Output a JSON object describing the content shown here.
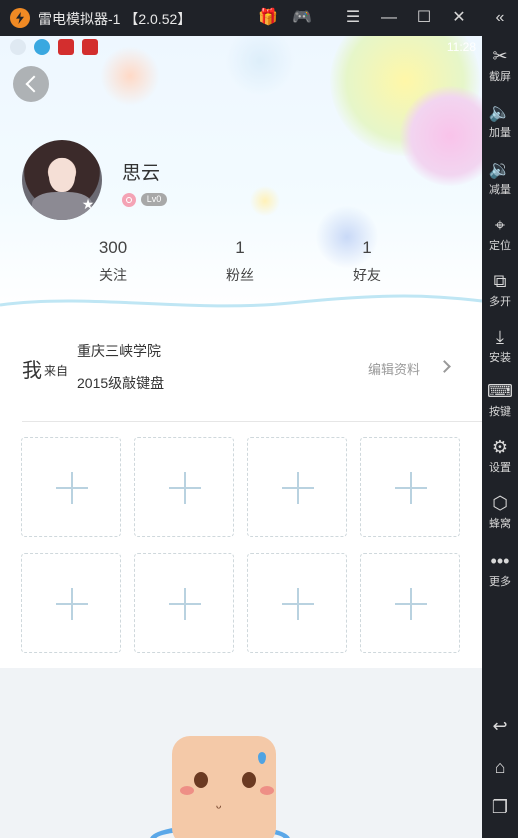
{
  "window": {
    "title": "雷电模拟器-1 【2.0.52】",
    "icons": [
      "gift-icon",
      "gamepad-icon",
      "menu-icon",
      "minimize-icon",
      "maximize-icon",
      "close-icon",
      "collapse-sidebar-icon"
    ]
  },
  "status_bar": {
    "time": "11:28"
  },
  "profile": {
    "name": "思云",
    "level": "Lv0",
    "stats": [
      {
        "value": "300",
        "label": "关注"
      },
      {
        "value": "1",
        "label": "粉丝"
      },
      {
        "value": "1",
        "label": "好友"
      }
    ]
  },
  "from": {
    "wo": "我",
    "from_label": "来自",
    "school": "重庆三峡学院",
    "class": "2015级敲键盘",
    "edit_label": "编辑资料"
  },
  "photo_slots": 8,
  "sidebar": {
    "items": [
      {
        "icon": "scissors-icon",
        "label": "截屏"
      },
      {
        "icon": "volume-up-icon",
        "label": "加量"
      },
      {
        "icon": "volume-down-icon",
        "label": "减量"
      },
      {
        "icon": "location-icon",
        "label": "定位"
      },
      {
        "icon": "multi-window-icon",
        "label": "多开"
      },
      {
        "icon": "apk-install-icon",
        "label": "安装"
      },
      {
        "icon": "keyboard-icon",
        "label": "按键"
      },
      {
        "icon": "settings-icon",
        "label": "设置"
      },
      {
        "icon": "hive-icon",
        "label": "蜂窝"
      },
      {
        "icon": "more-icon",
        "label": "更多"
      }
    ],
    "nav": [
      "back-icon",
      "home-icon",
      "recents-icon"
    ]
  }
}
